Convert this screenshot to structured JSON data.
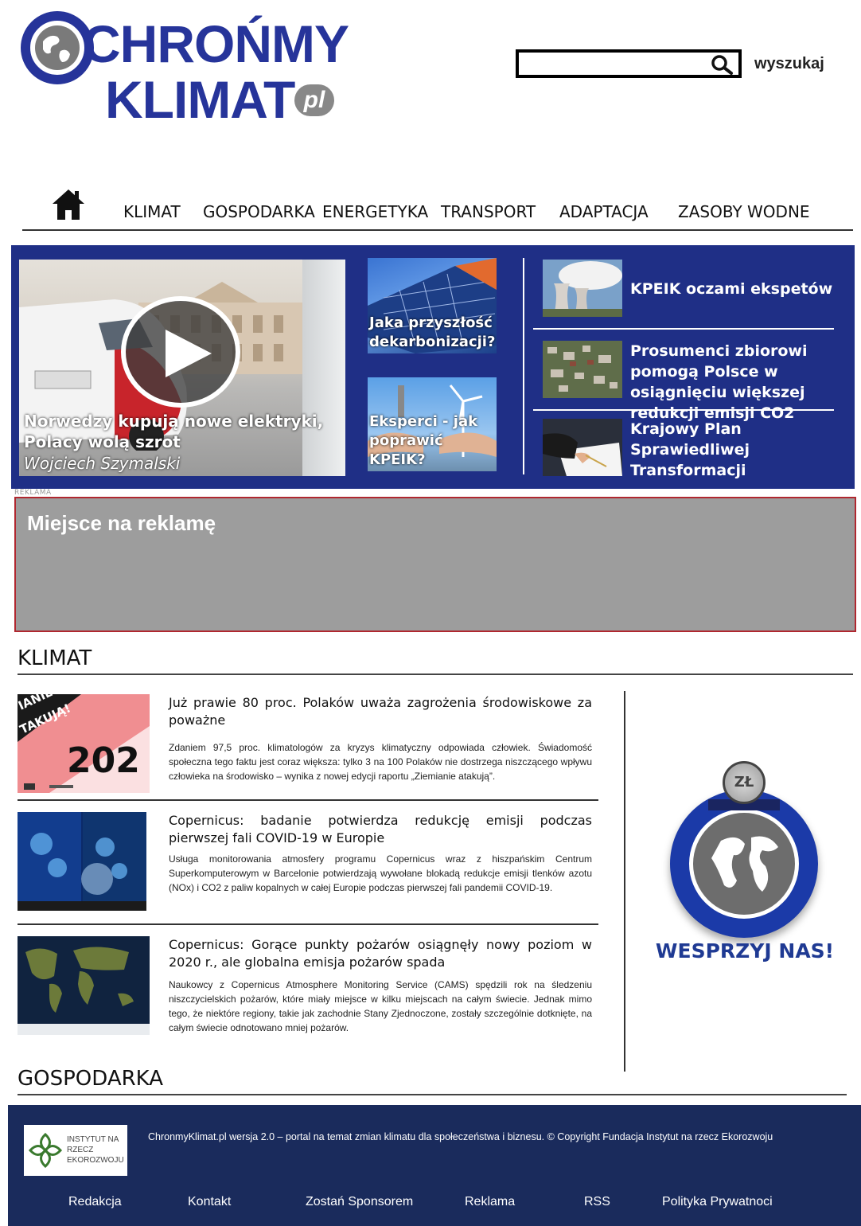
{
  "header": {
    "logo_top": "CHROŃMY",
    "logo_bottom": "KLIMAT",
    "logo_suffix": "pl",
    "search_label": "wyszukaj"
  },
  "nav": {
    "items": [
      "KLIMAT",
      "GOSPODARKA",
      "ENERGETYKA",
      "TRANSPORT",
      "ADAPTACJA",
      "ZASOBY WODNE"
    ]
  },
  "hero": {
    "main_title": "Norwedzy kupują nowe elektryki, Polacy wolą szrot",
    "main_author": "Wojciech Szymalski",
    "mid": [
      {
        "caption": "Jaka przyszłość dekarbonizacji?"
      },
      {
        "caption": "Eksperci - jak poprawić KPEIK?"
      }
    ],
    "side": [
      {
        "title": "KPEIK oczami ekspetów"
      },
      {
        "title": "Prosumenci zbiorowi pomogą Polsce w osiągnięciu większej redukcji emisji CO2"
      },
      {
        "title": "Krajowy Plan Sprawiedliwej Transformacji"
      }
    ]
  },
  "ad": {
    "label": "REKLAMA",
    "text": "Miejsce na reklamę"
  },
  "sections": {
    "klimat": "KLIMAT",
    "gospodarka": "GOSPODARKA"
  },
  "articles": [
    {
      "title": "Już prawie 80 proc. Polaków uważa zagrożenia środowiskowe za poważne",
      "text": "Zdaniem 97,5 proc. klimatologów za kryzys klimatyczny odpowiada człowiek. Świadomość społeczna tego faktu jest coraz większa: tylko 3 na 100 Polaków nie dostrzega niszczącego wpływu człowieka na środowisko – wynika z nowej edycji raportu „Ziemianie atakują”.",
      "thumb_text_1": "IANIE",
      "thumb_text_2": "TAKUJĄ!",
      "thumb_text_3": "202"
    },
    {
      "title": "Copernicus: badanie potwierdza redukcję emisji podczas pierwszej fali COVID-19 w Europie",
      "text": "Usługa monitorowania atmosfery programu Copernicus wraz z hiszpańskim Centrum Superkomputerowym w Barcelonie potwierdzają wywołane blokadą redukcje emisji tlenków azotu (NOx) i CO2 z paliw kopalnych w całej Europie podczas pierwszej fali pandemii COVID-19."
    },
    {
      "title": "Copernicus: Gorące punkty pożarów osiągnęły nowy poziom w 2020 r., ale globalna emisja pożarów spada",
      "text": "Naukowcy z Copernicus Atmosphere Monitoring Service (CAMS) spędzili rok na śledzeniu niszczycielskich pożarów, które miały miejsce w kilku miejscach na całym świecie. Jednak mimo tego, że niektóre regiony, takie jak zachodnie Stany Zjednoczone, zostały szczególnie dotknięte, na całym świecie odnotowano mniej pożarów."
    }
  ],
  "donate": {
    "coin": "ZŁ",
    "label": "WESPRZYJ NAS!"
  },
  "footer": {
    "logo_text": "INSTYTUT NA RZECZ EKOROZWOJU",
    "copyright": "ChronmyKlimat.pl wersja 2.0 – portal na temat zmian klimatu dla społeczeństwa i biznesu. © Copyright Fundacja Instytut na rzecz Ekorozwoju",
    "links": [
      "Redakcja",
      "Kontakt",
      "Zostań Sponsorem",
      "Reklama",
      "RSS",
      "Polityka Prywatnoci"
    ]
  },
  "colors": {
    "brand_blue": "#26349a",
    "hero_bg": "#1f2f86",
    "footer_bg": "#1a2b5c",
    "ad_bg": "#9d9d9d",
    "ad_border": "#b0272f"
  }
}
